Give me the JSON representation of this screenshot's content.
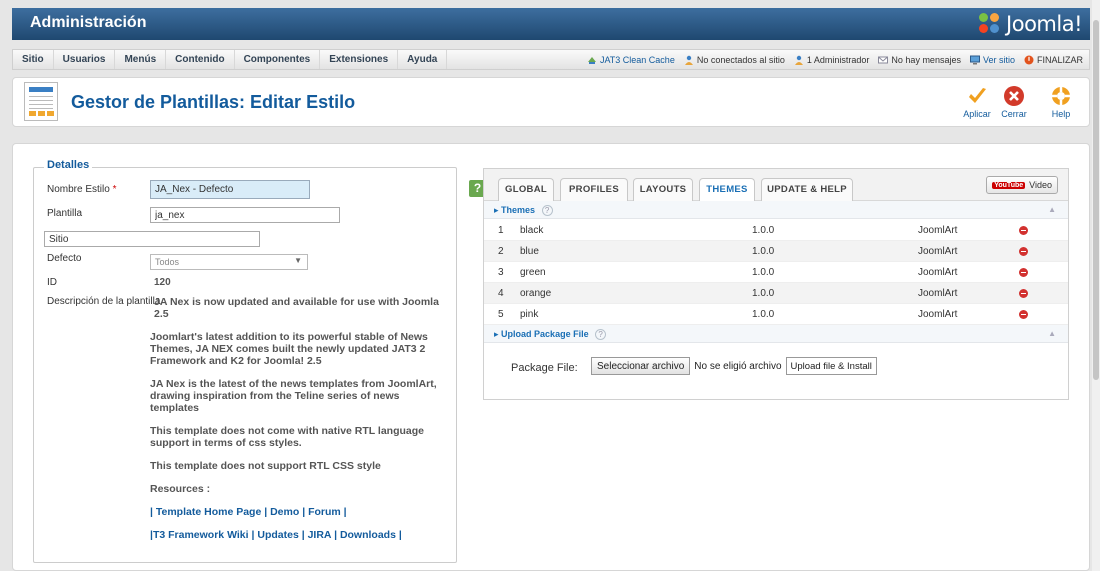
{
  "header": {
    "title": "Administración",
    "logo_text": "Joomla!"
  },
  "menu": {
    "items": [
      "Sitio",
      "Usuarios",
      "Menús",
      "Contenido",
      "Componentes",
      "Extensiones",
      "Ayuda"
    ],
    "status": {
      "cache": "JAT3 Clean Cache",
      "not_connected": "No conectados al sitio",
      "admins": "1 Administrador",
      "messages": "No hay mensajes",
      "view_site": "Ver sitio",
      "logout": "FINALIZAR"
    }
  },
  "toolbar": {
    "page_title": "Gestor de Plantillas: Editar Estilo",
    "apply_label": "Aplicar",
    "close_label": "Cerrar",
    "help_label": "Help"
  },
  "details": {
    "legend": "Detalles",
    "style_name_label": "Nombre Estilo",
    "required_mark": "*",
    "style_name_value": "JA_Nex - Defecto",
    "template_label": "Plantilla",
    "template_value": "ja_nex",
    "site_value": "Sitio",
    "default_label": "Defecto",
    "default_value": "Todos",
    "id_label": "ID",
    "id_value": "120",
    "description_label": "Descripción de la plantilla",
    "description": {
      "p1": "JA Nex is now updated and available for use with Joomla 2.5",
      "p2": "Joomlart's latest addition to its powerful stable of News Themes, JA NEX comes built the newly updated JAT3 2 Framework and K2 for Joomla! 2.5",
      "p3": "JA Nex is the latest of the news templates from JoomlArt, drawing inspiration from the Teline series of news templates",
      "p4": "This template does not come with native RTL language support in terms of css styles.",
      "p5": "This template does not support RTL CSS style",
      "resources": "Resources :",
      "sep": "|",
      "link_home": "Template Home Page",
      "link_demo": "Demo",
      "link_forum": "Forum",
      "link_wiki": "T3 Framework Wiki",
      "link_updates": "Updates",
      "link_jira": "JIRA",
      "link_downloads": "Downloads"
    }
  },
  "panel": {
    "help_badge": "?",
    "tabs": [
      "GLOBAL",
      "PROFILES",
      "LAYOUTS",
      "THEMES",
      "UPDATE & HELP"
    ],
    "active_tab": "THEMES",
    "video_label": "Video",
    "youtube_logo": "YouTube",
    "themes_section": "Themes",
    "question_mark": "?",
    "themes": [
      {
        "num": "1",
        "name": "black",
        "version": "1.0.0",
        "author": "JoomlArt"
      },
      {
        "num": "2",
        "name": "blue",
        "version": "1.0.0",
        "author": "JoomlArt"
      },
      {
        "num": "3",
        "name": "green",
        "version": "1.0.0",
        "author": "JoomlArt"
      },
      {
        "num": "4",
        "name": "orange",
        "version": "1.0.0",
        "author": "JoomlArt"
      },
      {
        "num": "5",
        "name": "pink",
        "version": "1.0.0",
        "author": "JoomlArt"
      }
    ],
    "upload_section": "Upload Package File",
    "package_label": "Package File:",
    "choose_file": "Seleccionar archivo",
    "no_file": "No se eligió archivo",
    "upload_button": "Upload file & Install"
  },
  "colors": {
    "header_bg": "#2c5a8a",
    "accent": "#135b9c",
    "active_tab": "#1a6fb5",
    "delete_red": "#d2312f"
  }
}
